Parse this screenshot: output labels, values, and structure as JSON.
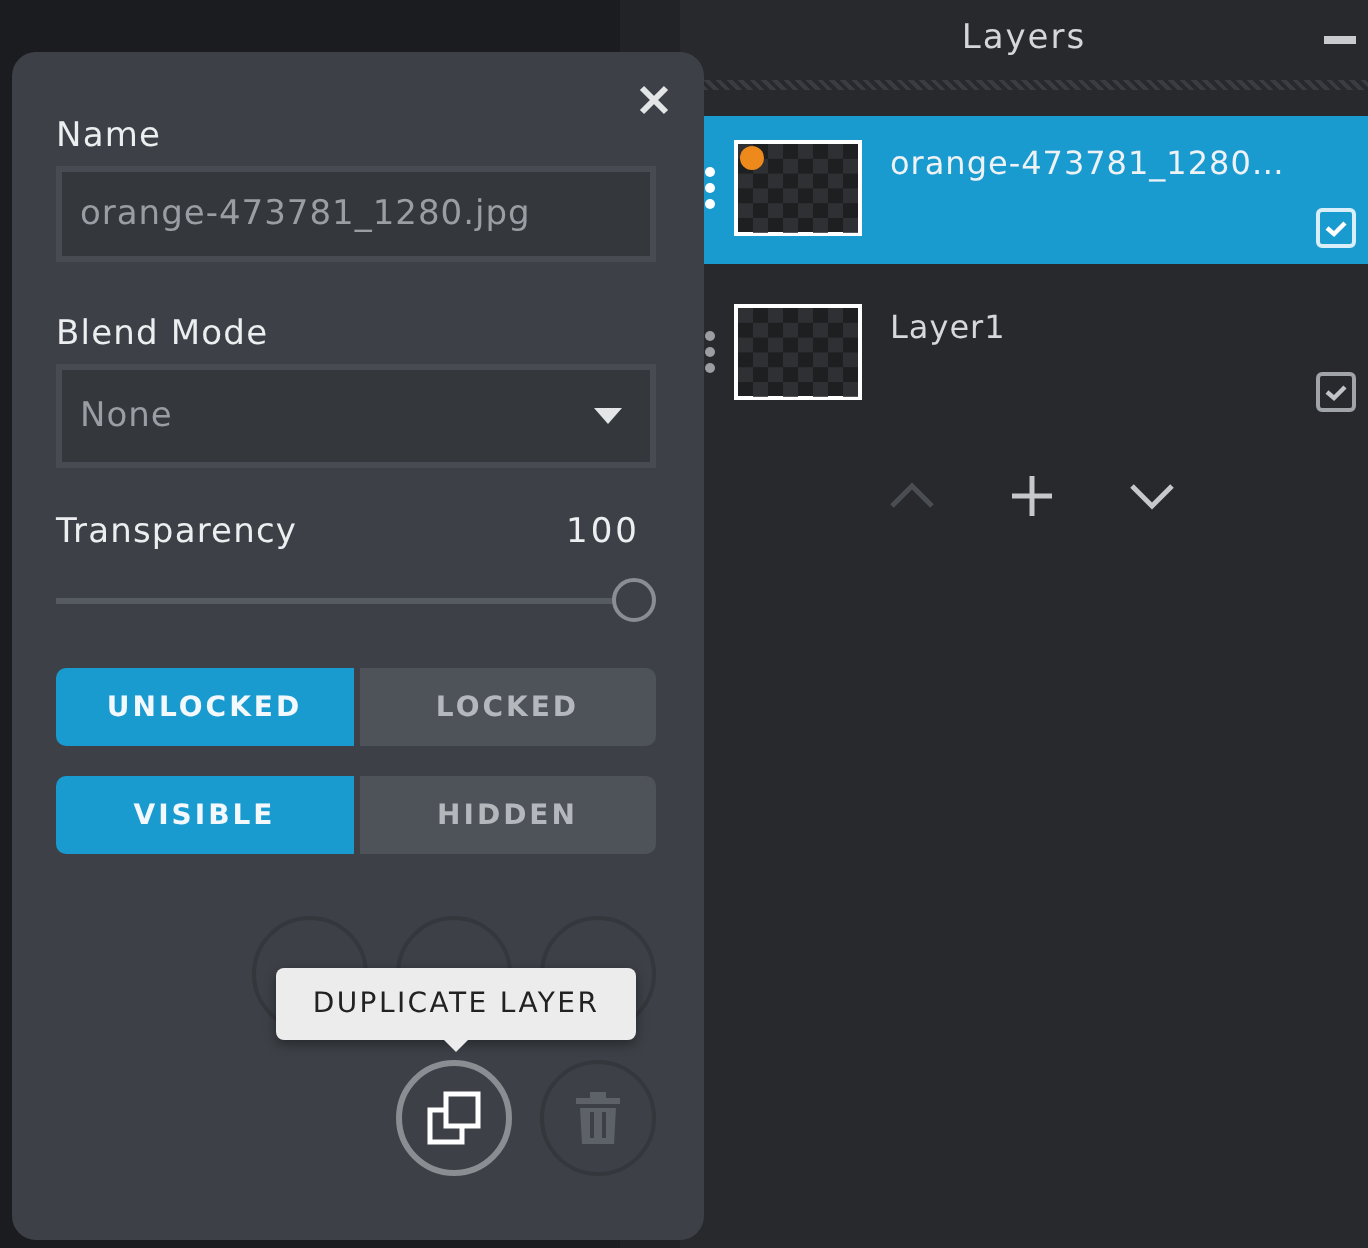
{
  "layers_panel": {
    "title": "Layers",
    "layers": [
      {
        "name": "orange-473781_1280…",
        "selected": true,
        "visible": true,
        "kind": "image"
      },
      {
        "name": "Layer1",
        "selected": false,
        "visible": true,
        "kind": "empty"
      }
    ],
    "reorder_buttons": [
      {
        "kind": "up",
        "disabled": true
      },
      {
        "kind": "add",
        "disabled": false
      },
      {
        "kind": "down",
        "disabled": false
      }
    ]
  },
  "layer_settings": {
    "name_label": "Name",
    "name_value": "orange-473781_1280.jpg",
    "blend_label": "Blend Mode",
    "blend_value": "None",
    "transparency_label": "Transparency",
    "transparency_value": "100",
    "level": 1.0,
    "lock_toggle": [
      {
        "label": "UNLOCKED",
        "selected": true
      },
      {
        "label": "LOCKED",
        "selected": false
      }
    ],
    "visibility_toggle": [
      {
        "label": "VISIBLE",
        "selected": true
      },
      {
        "label": "HIDDEN",
        "selected": false
      }
    ],
    "actions": [
      {
        "kind": "covered",
        "hovered": false
      },
      {
        "kind": "covered",
        "hovered": false
      },
      {
        "kind": "covered",
        "hovered": false
      },
      {
        "kind": "duplicate",
        "hovered": true
      },
      {
        "kind": "delete",
        "hovered": false
      }
    ],
    "tooltip": "DUPLICATE LAYER"
  }
}
